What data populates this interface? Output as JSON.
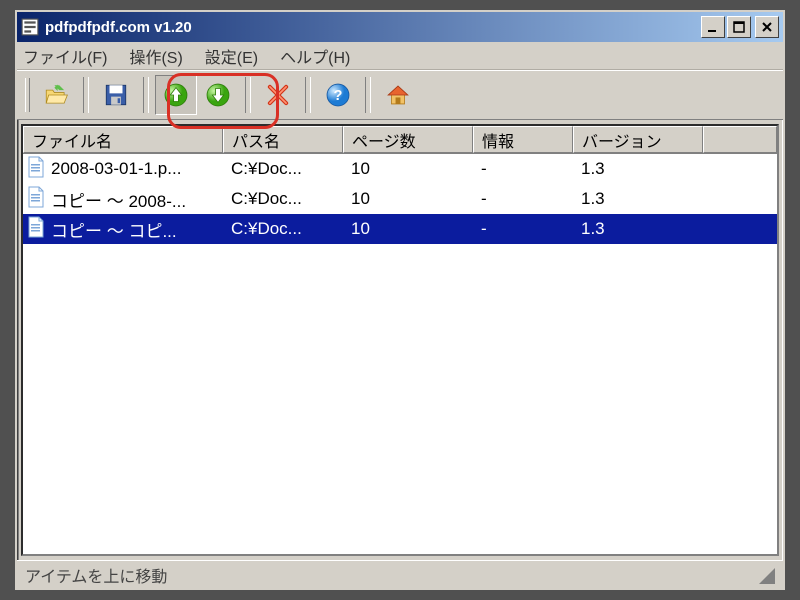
{
  "window": {
    "title": "pdfpdfpdf.com v1.20"
  },
  "menubar": {
    "file": "ファイル(F)",
    "operate": "操作(S)",
    "settings": "設定(E)",
    "help": "ヘルプ(H)"
  },
  "columns": {
    "filename": "ファイル名",
    "path": "パス名",
    "pages": "ページ数",
    "info": "情報",
    "version": "バージョン"
  },
  "rows": [
    {
      "filename": "2008-03-01-1.p...",
      "path": "C:¥Doc...",
      "pages": "10",
      "info": "-",
      "version": "1.3",
      "selected": false
    },
    {
      "filename": "コピー ～ 2008-...",
      "path": "C:¥Doc...",
      "pages": "10",
      "info": "-",
      "version": "1.3",
      "selected": false
    },
    {
      "filename": "コピー ～ コピ...",
      "path": "C:¥Doc...",
      "pages": "10",
      "info": "-",
      "version": "1.3",
      "selected": true
    }
  ],
  "statusbar": {
    "text": "アイテムを上に移動"
  },
  "icons": {
    "open": "folder-open-icon",
    "save": "save-icon",
    "up": "arrow-up-icon",
    "down": "arrow-down-icon",
    "delete": "delete-x-icon",
    "help": "help-icon",
    "home": "home-icon"
  }
}
